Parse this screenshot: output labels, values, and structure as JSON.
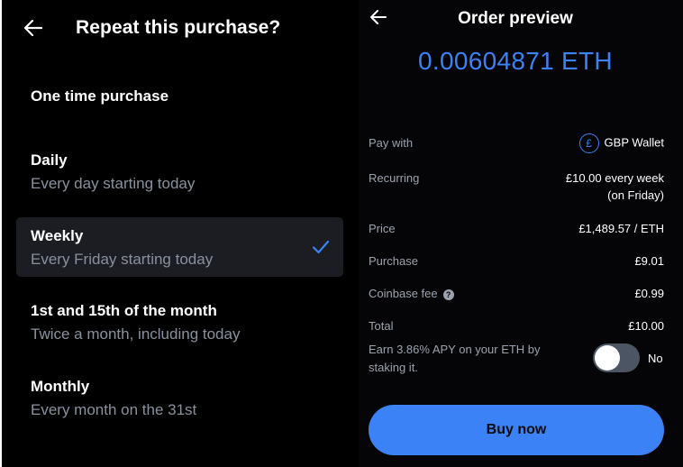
{
  "frequency_screen": {
    "title": "Repeat this purchase?",
    "options": [
      {
        "title": "One time purchase",
        "subtitle": ""
      },
      {
        "title": "Daily",
        "subtitle": "Every day starting today"
      },
      {
        "title": "Weekly",
        "subtitle": "Every Friday starting today",
        "selected": true
      },
      {
        "title": "1st and 15th of the month",
        "subtitle": "Twice a month, including today"
      },
      {
        "title": "Monthly",
        "subtitle": "Every month on the 31st"
      }
    ]
  },
  "order_preview": {
    "title": "Order preview",
    "amount": "0.00604871 ETH",
    "pay_with_label": "Pay with",
    "pay_with_value": "GBP Wallet",
    "wallet_icon_glyph": "£",
    "recurring_label": "Recurring",
    "recurring_value_line1": "£10.00 every week",
    "recurring_value_line2": "(on Friday)",
    "price_label": "Price",
    "price_value": "£1,489.57 / ETH",
    "purchase_label": "Purchase",
    "purchase_value": "£9.01",
    "fee_label": "Coinbase fee",
    "fee_value": "£0.99",
    "total_label": "Total",
    "total_value": "£10.00",
    "staking_text": "Earn 3.86% APY on your ETH by staking it.",
    "staking_toggle_label": "No",
    "staking_enabled": false,
    "buy_button": "Buy now"
  },
  "colors": {
    "accent": "#3b82f6",
    "background": "#000000",
    "selected_row": "#1b1d22",
    "muted_text": "#8a919e"
  }
}
